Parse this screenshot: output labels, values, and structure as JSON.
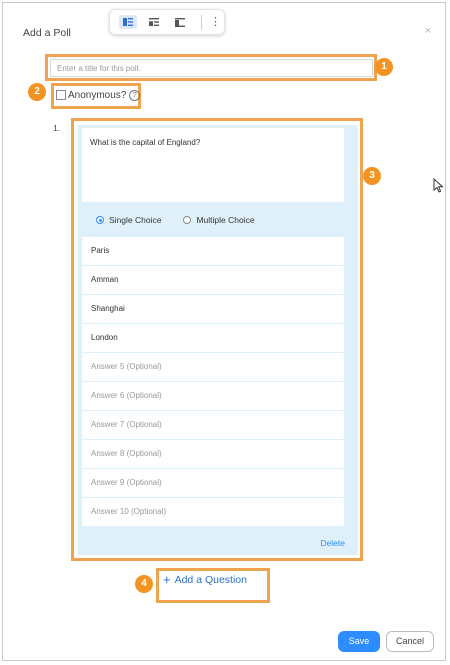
{
  "dialog": {
    "title": "Add a Poll",
    "close": "×"
  },
  "toolbar": {
    "more": "⋮"
  },
  "poll": {
    "title_placeholder": "Enter a title for this poll.",
    "anonymous_label": "Anonymous?",
    "help": "?"
  },
  "question": {
    "number": "1.",
    "text": "What is the capital of England?",
    "type_options": [
      "Single Choice",
      "Multiple Choice"
    ],
    "selected_type": "Single Choice",
    "answers": [
      {
        "label": "Paris",
        "optional": false
      },
      {
        "label": "Amman",
        "optional": false
      },
      {
        "label": "Shanghai",
        "optional": false
      },
      {
        "label": "London",
        "optional": false
      },
      {
        "label": "Answer 5 (Optional)",
        "optional": true
      },
      {
        "label": "Answer 6 (Optional)",
        "optional": true
      },
      {
        "label": "Answer 7 (Optional)",
        "optional": true
      },
      {
        "label": "Answer 8 (Optional)",
        "optional": true
      },
      {
        "label": "Answer 9 (Optional)",
        "optional": true
      },
      {
        "label": "Answer 10 (Optional)",
        "optional": true
      }
    ],
    "delete_label": "Delete"
  },
  "add_question": {
    "plus": "+",
    "label": "Add a Question"
  },
  "footer": {
    "save_label": "Save",
    "cancel_label": "Cancel"
  },
  "callouts": [
    "1",
    "2",
    "3",
    "4"
  ],
  "colors": {
    "accent": "#2d8cff",
    "callout": "#f29322",
    "card_bg": "#dff0fb"
  }
}
